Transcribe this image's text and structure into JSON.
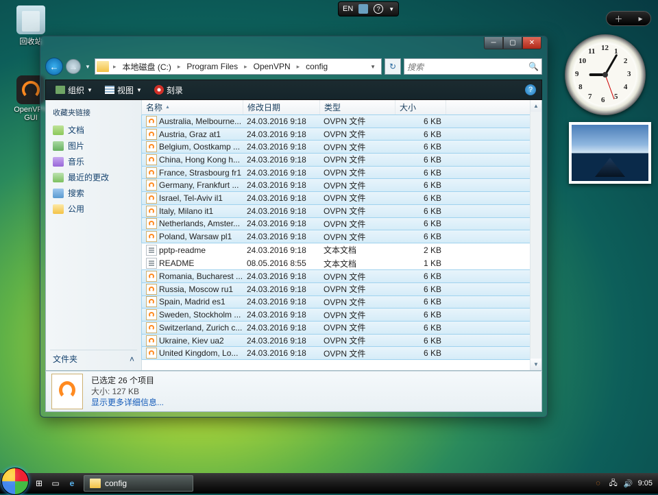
{
  "desktop": {
    "recycle": "回收站",
    "openvpn_gui": "OpenVPN GUI"
  },
  "langbar": {
    "lang": "EN"
  },
  "clock_numbers": [
    "12",
    "1",
    "2",
    "3",
    "4",
    "5",
    "6",
    "7",
    "8",
    "9",
    "10",
    "11"
  ],
  "window": {
    "nav_back": "←",
    "nav_fwd": "→",
    "breadcrumb": [
      "本地磁盘 (C:)",
      "Program Files",
      "OpenVPN",
      "config"
    ],
    "search_placeholder": "搜索",
    "toolbar": {
      "organize": "组织",
      "views": "视图",
      "burn": "刻录"
    },
    "sidebar": {
      "favorites": "收藏夹链接",
      "items": [
        {
          "label": "文档",
          "ic": "ic-doc"
        },
        {
          "label": "图片",
          "ic": "ic-pic"
        },
        {
          "label": "音乐",
          "ic": "ic-mus"
        },
        {
          "label": "最近的更改",
          "ic": "ic-rec"
        },
        {
          "label": "搜索",
          "ic": "ic-sea"
        },
        {
          "label": "公用",
          "ic": "ic-pub"
        }
      ],
      "folders": "文件夹"
    },
    "columns": {
      "name": "名称",
      "date": "修改日期",
      "type": "类型",
      "size": "大小"
    },
    "rows": [
      {
        "sel": true,
        "ic": "ic-ovpn",
        "name": "Australia, Melbourne...",
        "date": "24.03.2016 9:18",
        "type": "OVPN 文件",
        "size": "6 KB"
      },
      {
        "sel": true,
        "ic": "ic-ovpn",
        "name": "Austria, Graz at1",
        "date": "24.03.2016 9:18",
        "type": "OVPN 文件",
        "size": "6 KB"
      },
      {
        "sel": true,
        "ic": "ic-ovpn",
        "name": "Belgium, Oostkamp ...",
        "date": "24.03.2016 9:18",
        "type": "OVPN 文件",
        "size": "6 KB"
      },
      {
        "sel": true,
        "ic": "ic-ovpn",
        "name": "China, Hong Kong h...",
        "date": "24.03.2016 9:18",
        "type": "OVPN 文件",
        "size": "6 KB"
      },
      {
        "sel": true,
        "ic": "ic-ovpn",
        "name": "France, Strasbourg fr1",
        "date": "24.03.2016 9:18",
        "type": "OVPN 文件",
        "size": "6 KB"
      },
      {
        "sel": true,
        "ic": "ic-ovpn",
        "name": "Germany, Frankfurt ...",
        "date": "24.03.2016 9:18",
        "type": "OVPN 文件",
        "size": "6 KB"
      },
      {
        "sel": true,
        "ic": "ic-ovpn",
        "name": "Israel, Tel-Aviv il1",
        "date": "24.03.2016 9:18",
        "type": "OVPN 文件",
        "size": "6 KB"
      },
      {
        "sel": true,
        "ic": "ic-ovpn",
        "name": "Italy, Milano it1",
        "date": "24.03.2016 9:18",
        "type": "OVPN 文件",
        "size": "6 KB"
      },
      {
        "sel": true,
        "ic": "ic-ovpn",
        "name": "Netherlands, Amster...",
        "date": "24.03.2016 9:18",
        "type": "OVPN 文件",
        "size": "6 KB"
      },
      {
        "sel": true,
        "ic": "ic-ovpn",
        "name": "Poland, Warsaw pl1",
        "date": "24.03.2016 9:18",
        "type": "OVPN 文件",
        "size": "6 KB"
      },
      {
        "sel": false,
        "ic": "ic-txt",
        "name": "pptp-readme",
        "date": "24.03.2016 9:18",
        "type": "文本文档",
        "size": "2 KB"
      },
      {
        "sel": false,
        "ic": "ic-txt",
        "name": "README",
        "date": "08.05.2016 8:55",
        "type": "文本文档",
        "size": "1 KB"
      },
      {
        "sel": true,
        "ic": "ic-ovpn",
        "name": "Romania, Bucharest ...",
        "date": "24.03.2016 9:18",
        "type": "OVPN 文件",
        "size": "6 KB"
      },
      {
        "sel": true,
        "ic": "ic-ovpn",
        "name": "Russia, Moscow ru1",
        "date": "24.03.2016 9:18",
        "type": "OVPN 文件",
        "size": "6 KB"
      },
      {
        "sel": true,
        "ic": "ic-ovpn",
        "name": "Spain, Madrid es1",
        "date": "24.03.2016 9:18",
        "type": "OVPN 文件",
        "size": "6 KB"
      },
      {
        "sel": true,
        "ic": "ic-ovpn",
        "name": "Sweden, Stockholm ...",
        "date": "24.03.2016 9:18",
        "type": "OVPN 文件",
        "size": "6 KB"
      },
      {
        "sel": true,
        "ic": "ic-ovpn",
        "name": "Switzerland, Zurich c...",
        "date": "24.03.2016 9:18",
        "type": "OVPN 文件",
        "size": "6 KB"
      },
      {
        "sel": true,
        "ic": "ic-ovpn",
        "name": "Ukraine, Kiev ua2",
        "date": "24.03.2016 9:18",
        "type": "OVPN 文件",
        "size": "6 KB"
      },
      {
        "sel": true,
        "ic": "ic-ovpn",
        "name": "United Kingdom, Lo...",
        "date": "24.03.2016 9:18",
        "type": "OVPN 文件",
        "size": "6 KB"
      }
    ],
    "details": {
      "line1": "已选定 26 个项目",
      "line2": "大小: 127 KB",
      "more": "显示更多详细信息..."
    }
  },
  "taskbar": {
    "task": "config",
    "time": "9:05"
  }
}
